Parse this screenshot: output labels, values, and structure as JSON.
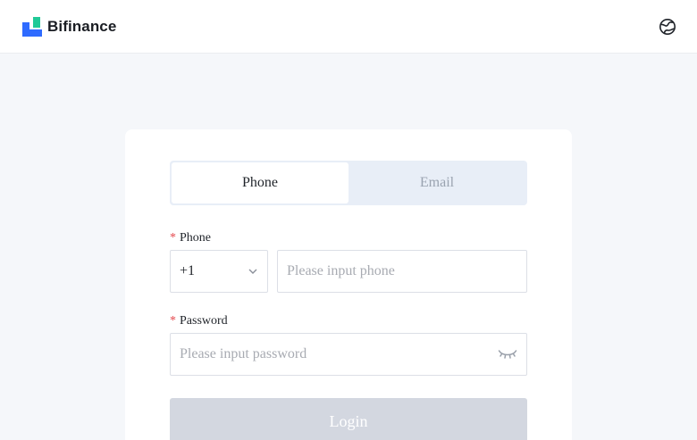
{
  "header": {
    "brand": "Bifinance",
    "logo_icon": "bifinance-logo-icon",
    "language_icon": "globe-icon"
  },
  "login": {
    "tabs": [
      {
        "label": "Phone",
        "active": true
      },
      {
        "label": "Email",
        "active": false
      }
    ],
    "phone_label": "Phone",
    "country_code": "+1",
    "phone_placeholder": "Please input phone",
    "password_label": "Password",
    "password_placeholder": "Please input password",
    "password_toggle_icon": "eye-closed-icon",
    "submit_label": "Login",
    "required_marker": "*"
  },
  "colors": {
    "brand_blue": "#2f6bff",
    "page_background": "#f5f7fa",
    "tab_track": "#e8eef7",
    "button_disabled": "#d3d7e0",
    "required": "#e5484d"
  }
}
